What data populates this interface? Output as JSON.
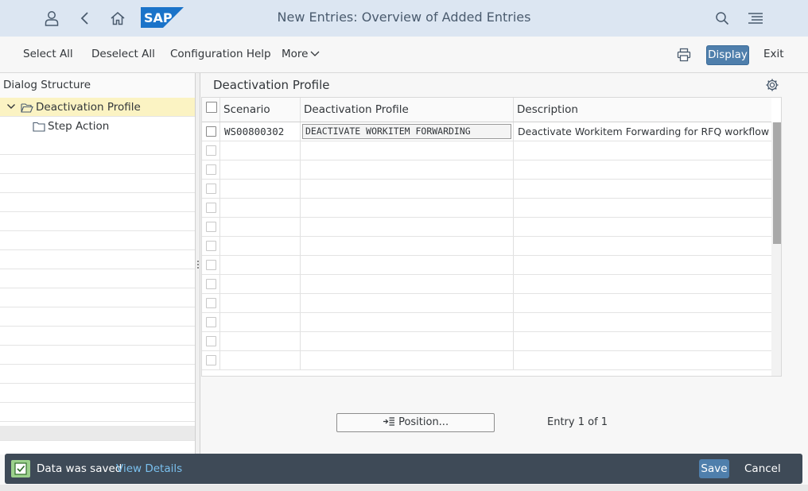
{
  "shell": {
    "title": "New Entries: Overview of Added Entries",
    "logo_text": "SAP",
    "icons": [
      "user-icon",
      "back-icon",
      "home-icon",
      "search-icon",
      "menu-icon"
    ]
  },
  "toolbar": {
    "select_all": "Select All",
    "deselect_all": "Deselect All",
    "configuration_help": "Configuration Help",
    "more": "More",
    "display": "Display",
    "exit": "Exit"
  },
  "dialog_structure": {
    "title": "Dialog Structure",
    "items": [
      {
        "label": "Deactivation Profile",
        "selected": true,
        "expanded": true
      },
      {
        "label": "Step Action",
        "selected": false
      }
    ]
  },
  "table": {
    "title": "Deactivation Profile",
    "columns": [
      "Scenario",
      "Deactivation Profile",
      "Description"
    ],
    "rows": [
      {
        "scenario": "WS00800302",
        "profile": "DEACTIVATE WORKITEM FORWARDING",
        "description": "Deactivate Workitem Forwarding for RFQ workflow"
      }
    ],
    "empty_rows": 12
  },
  "footer": {
    "position_button": "Position...",
    "entry_info": "Entry 1 of 1"
  },
  "message": {
    "text": "Data was saved",
    "link": "View Details",
    "save": "Save",
    "cancel": "Cancel"
  },
  "colors": {
    "shell": "#dce6f2",
    "emphasized_button": "#4f7fac",
    "selected_tree_row": "#fbf3c3",
    "message_bar": "#3e4a57",
    "success_icon": "#9cd18c",
    "link": "#7ac0ee"
  }
}
